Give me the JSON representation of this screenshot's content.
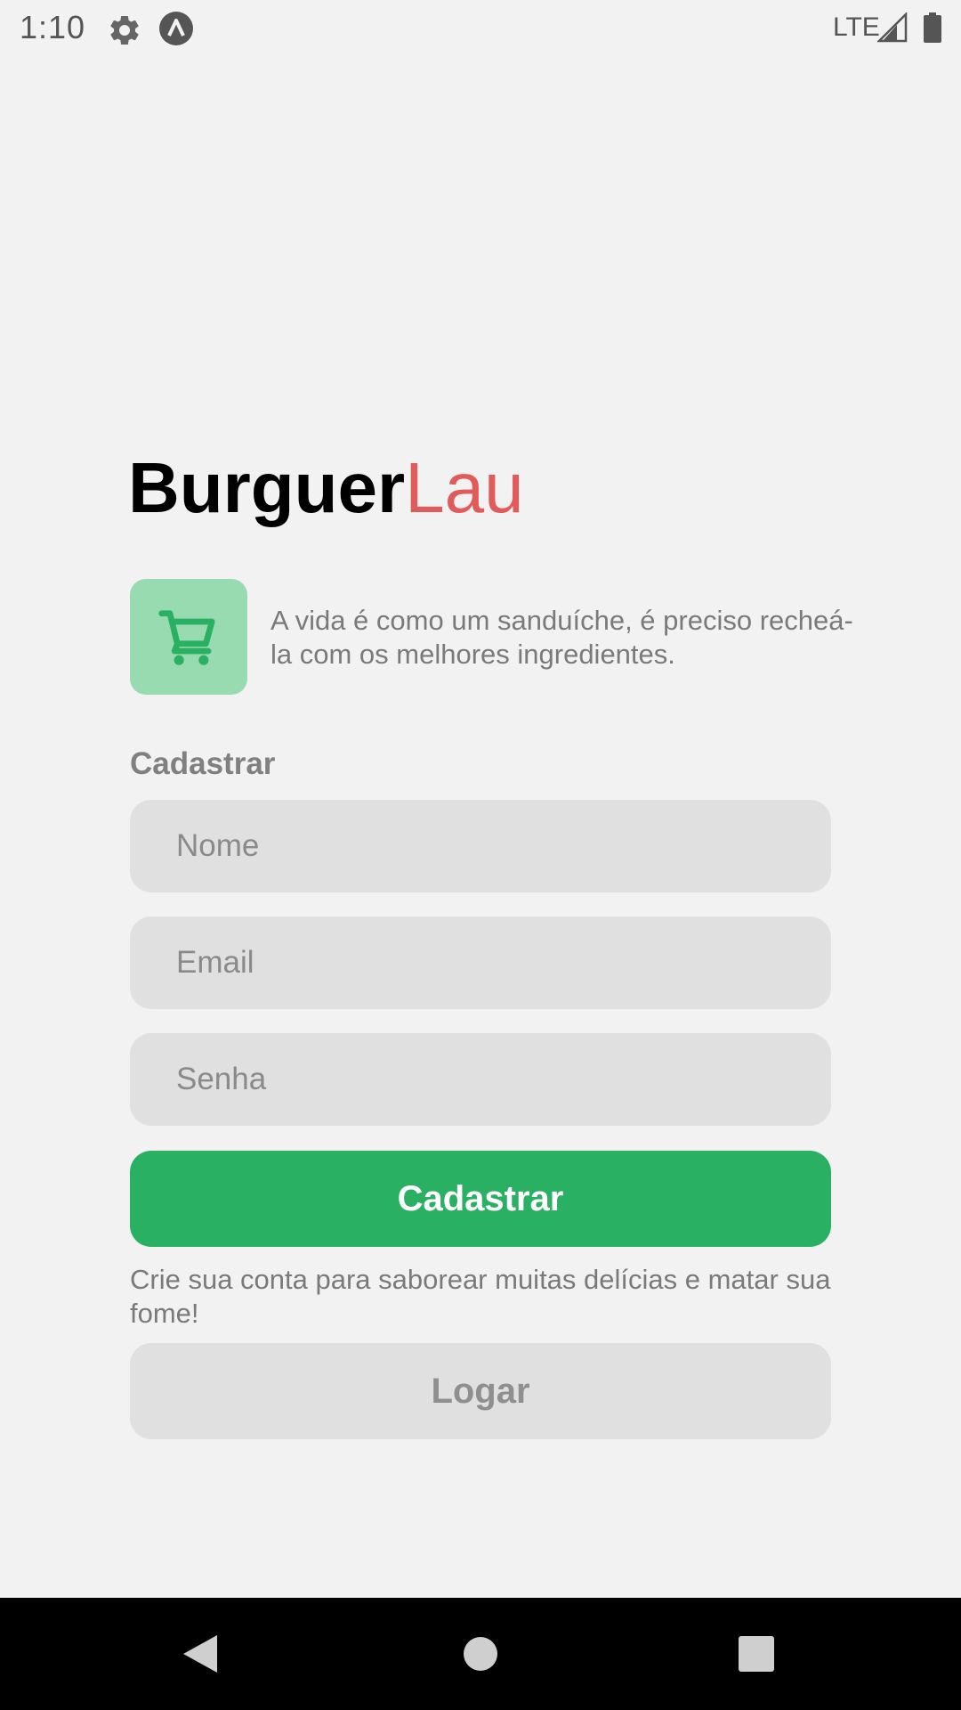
{
  "status_bar": {
    "time": "1:10",
    "network": "LTE",
    "icons": [
      "gear-icon",
      "app-notification-icon",
      "signal-icon",
      "battery-icon"
    ]
  },
  "brand": {
    "part1": "Burguer",
    "part2": "Lau",
    "accent_color": "#e15b5b"
  },
  "hero": {
    "icon": "shopping-cart-icon",
    "icon_bg": "#98dbb0",
    "icon_color": "#29b062",
    "tagline": "A vida é como um sanduíche, é preciso recheá-la com os melhores ingredientes."
  },
  "form": {
    "title": "Cadastrar",
    "fields": {
      "name": {
        "placeholder": "Nome",
        "value": ""
      },
      "email": {
        "placeholder": "Email",
        "value": ""
      },
      "password": {
        "placeholder": "Senha",
        "value": ""
      }
    },
    "submit_label": "Cadastrar",
    "submit_color": "#29b062",
    "helper_text": "Crie sua conta para saborear muitas delícias e matar sua fome!",
    "login_label": "Logar"
  },
  "nav_bar": {
    "icons": [
      "back-icon",
      "home-icon",
      "recents-icon"
    ]
  }
}
